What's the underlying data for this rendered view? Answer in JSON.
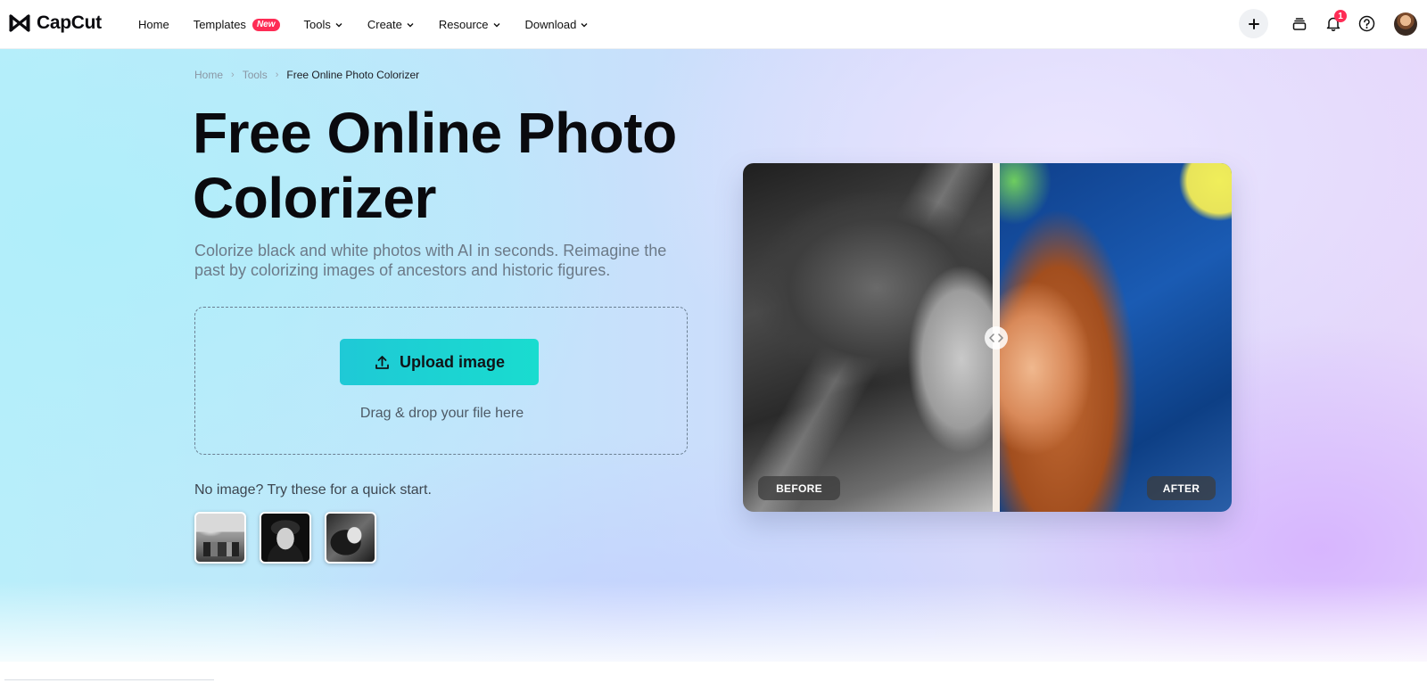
{
  "brand": {
    "name": "CapCut"
  },
  "nav": {
    "items": [
      {
        "label": "Home",
        "has_dropdown": false
      },
      {
        "label": "Templates",
        "has_dropdown": false,
        "badge": "New"
      },
      {
        "label": "Tools",
        "has_dropdown": true
      },
      {
        "label": "Create",
        "has_dropdown": true
      },
      {
        "label": "Resource",
        "has_dropdown": true
      },
      {
        "label": "Download",
        "has_dropdown": true
      }
    ],
    "notification_count": "1",
    "icons": [
      "plus-icon",
      "layers-icon",
      "bell-icon",
      "help-icon",
      "avatar"
    ]
  },
  "breadcrumb": {
    "items": [
      "Home",
      "Tools"
    ],
    "current": "Free Online Photo Colorizer"
  },
  "hero": {
    "title_line1": "Free Online Photo",
    "title_line2": "Colorizer",
    "subtitle": "Colorize black and white photos with AI in seconds. Reimagine the past by colorizing images of ancestors and historic figures.",
    "upload_label": "Upload image",
    "drop_text": "Drag & drop your file here",
    "quickstart_text": "No image? Try these for a quick start.",
    "samples": [
      "sample-street",
      "sample-portrait",
      "sample-couple"
    ]
  },
  "compare": {
    "before_label": "BEFORE",
    "after_label": "AFTER"
  },
  "colors": {
    "accent": "#1fd3d3",
    "badge": "#fe2c55",
    "text_dark": "#0a0a0e",
    "text_muted": "#6c7a88"
  }
}
